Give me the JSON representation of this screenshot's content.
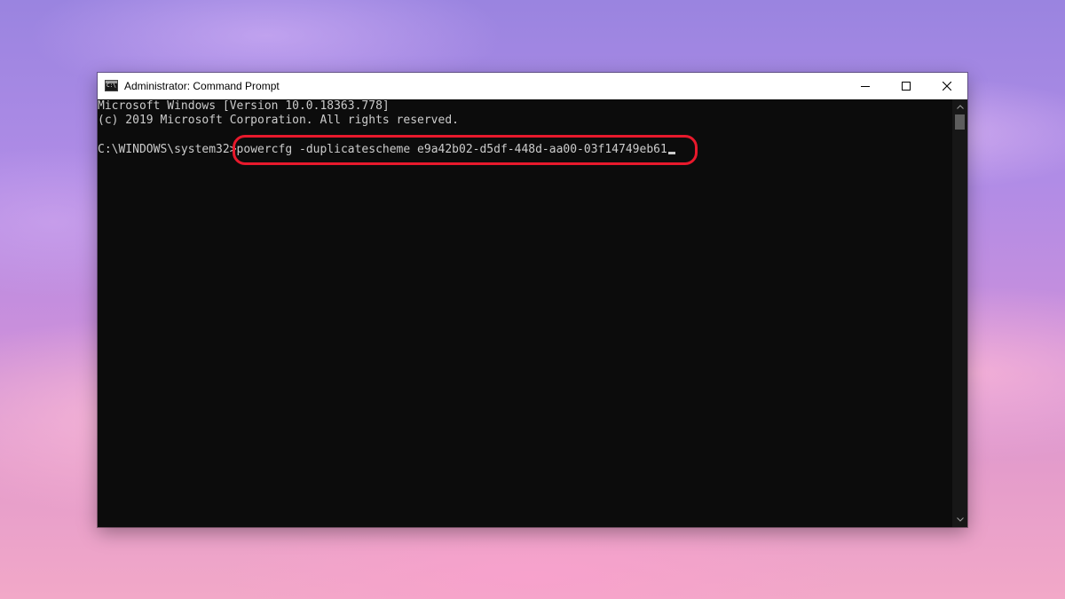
{
  "window": {
    "title": "Administrator: Command Prompt",
    "icon": "cmd-icon",
    "controls": {
      "minimize": "minimize-icon",
      "maximize": "maximize-icon",
      "close": "close-icon"
    }
  },
  "console": {
    "lines": [
      "Microsoft Windows [Version 10.0.18363.778]",
      "(c) 2019 Microsoft Corporation. All rights reserved."
    ],
    "prompt": "C:\\WINDOWS\\system32>",
    "command": "powercfg -duplicatescheme e9a42b02-d5df-448d-aa00-03f14749eb61"
  },
  "colors": {
    "console_background": "#0c0c0c",
    "console_text": "#cccccc",
    "titlebar": "#ffffff",
    "highlight_annotation": "#e8192c"
  }
}
